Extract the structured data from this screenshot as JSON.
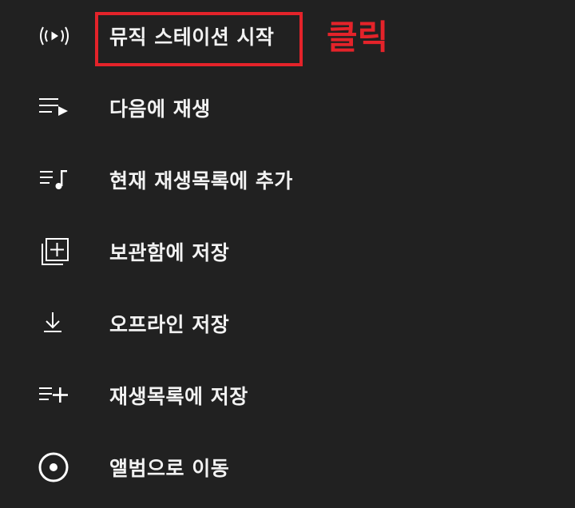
{
  "menu": {
    "items": [
      {
        "label": "뮤직 스테이션 시작",
        "icon": "radio-broadcast-icon"
      },
      {
        "label": "다음에 재생",
        "icon": "play-next-icon"
      },
      {
        "label": "현재 재생목록에 추가",
        "icon": "add-to-queue-icon"
      },
      {
        "label": "보관함에 저장",
        "icon": "library-add-icon"
      },
      {
        "label": "오프라인 저장",
        "icon": "download-icon"
      },
      {
        "label": "재생목록에 저장",
        "icon": "playlist-add-icon"
      },
      {
        "label": "앨범으로 이동",
        "icon": "album-icon"
      }
    ]
  },
  "annotation": {
    "text": "클릭",
    "color": "#e4232a"
  },
  "theme": {
    "background": "#212121",
    "text": "#f2f2f2",
    "icon": "#ffffff"
  }
}
